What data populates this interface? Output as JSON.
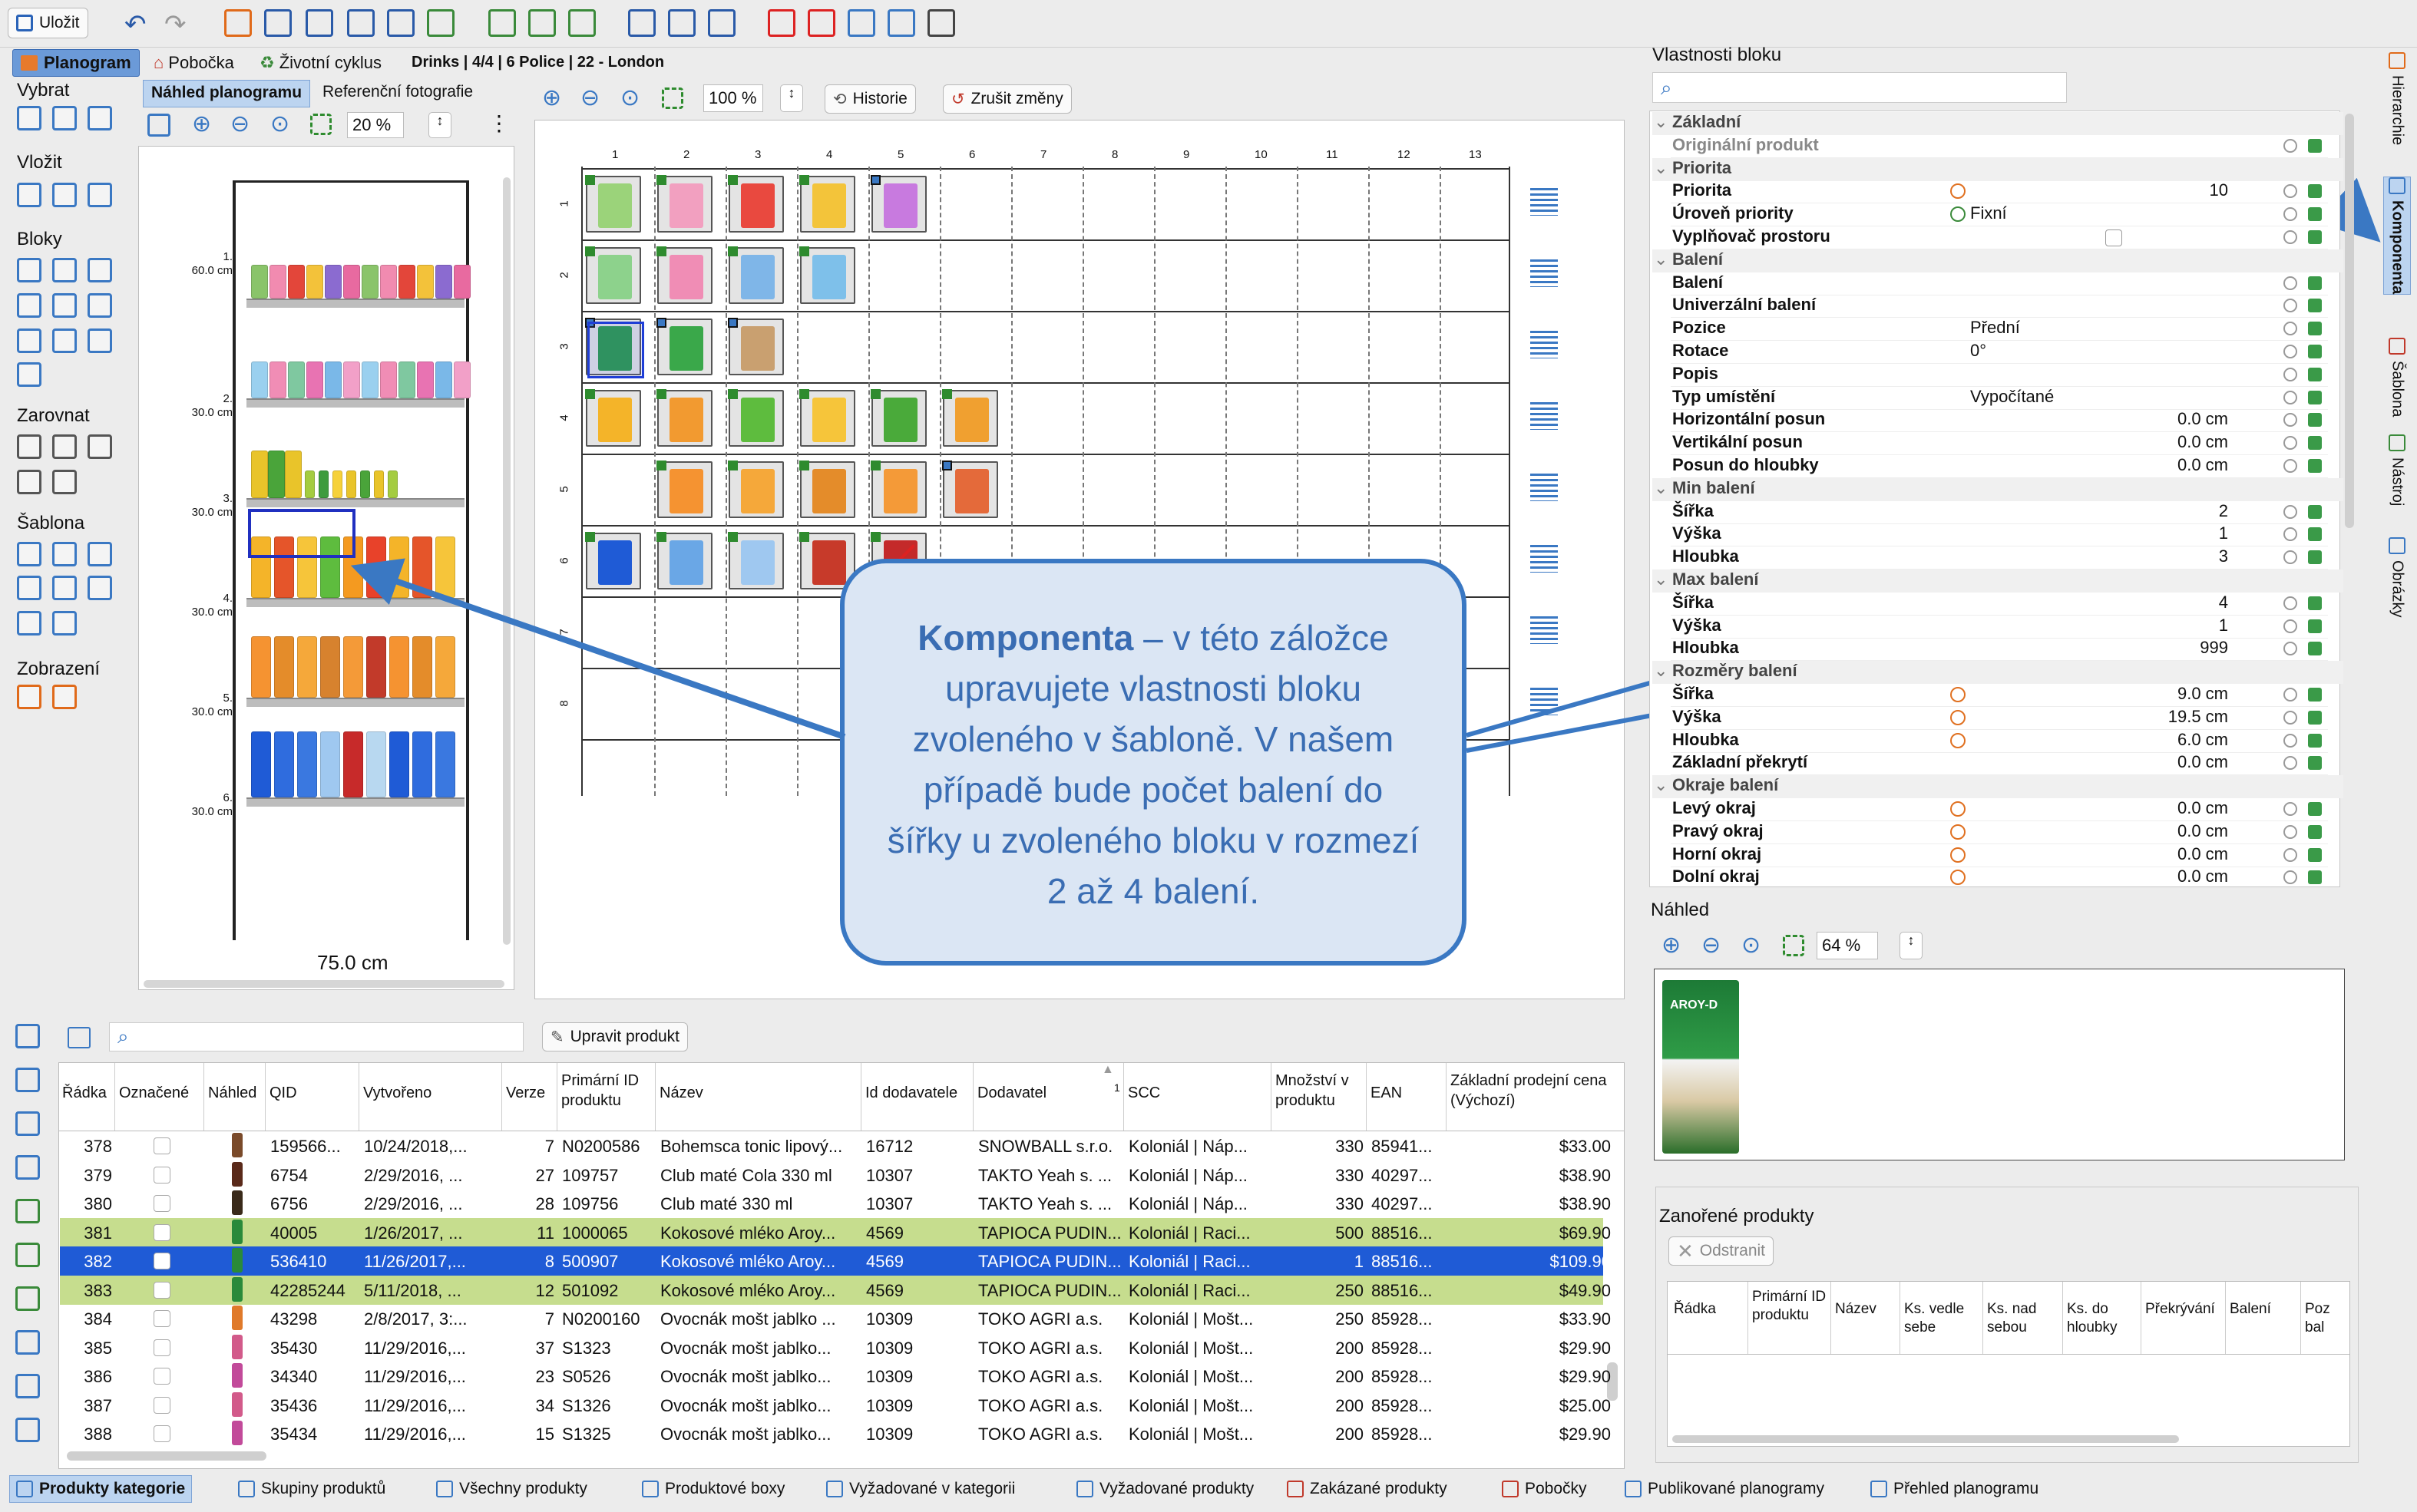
{
  "toolbar": {
    "save_label": "Uložit"
  },
  "breadcrumb": {
    "tab_active": "Planogram",
    "branch": "Pobočka",
    "lifecycle": "Životní cyklus",
    "path": "Drinks | 4/4 | 6 Police | 22 - London"
  },
  "preview_tabs": [
    "Náhled planogramu",
    "Referenční fotografie"
  ],
  "left_zoom": "20 %",
  "center_zoom": "100 %",
  "center_buttons": {
    "history": "Historie",
    "revert": "Zrušit změny"
  },
  "left_sections": [
    "Vybrat",
    "Vložit",
    "Bloky",
    "Zarovnat",
    "Šablona",
    "Zobrazení"
  ],
  "shelves": [
    {
      "n": "1.",
      "h": "60.0 cm"
    },
    {
      "n": "2.",
      "h": "30.0 cm"
    },
    {
      "n": "3.",
      "h": "30.0 cm"
    },
    {
      "n": "4.",
      "h": "30.0 cm"
    },
    {
      "n": "5.",
      "h": "30.0 cm"
    },
    {
      "n": "6.",
      "h": "30.0 cm"
    }
  ],
  "shelf_width": "75.0 cm",
  "grid_cols": [
    "1",
    "2",
    "3",
    "4",
    "5",
    "6",
    "7",
    "8",
    "9",
    "10",
    "11",
    "12",
    "13"
  ],
  "grid_rows": [
    "1",
    "2",
    "3",
    "4",
    "5",
    "6",
    "7",
    "8"
  ],
  "callout": {
    "title": "Komponenta",
    "text": " – v této záložce upravujete vlastnosti bloku zvoleného v šabloně. V našem případě bude počet balení do šířky u zvoleného bloku v rozmezí 2 až 4 balení."
  },
  "properties": {
    "title": "Vlastnosti bloku",
    "rows": [
      {
        "k": "Základní",
        "sec": true
      },
      {
        "k": "Originální produkt",
        "sub": true
      },
      {
        "k": "Priorita",
        "sec": true
      },
      {
        "k": "Priorita",
        "vr": "10",
        "orange": true
      },
      {
        "k": "Úroveň priority",
        "v": "Fixní",
        "green": true
      },
      {
        "k": "Vyplňovač prostoru",
        "check": true
      },
      {
        "k": "Balení",
        "sec": true
      },
      {
        "k": "Balení"
      },
      {
        "k": "Univerzální balení"
      },
      {
        "k": "Pozice",
        "v": "Přední"
      },
      {
        "k": "Rotace",
        "v": "0°"
      },
      {
        "k": "Popis"
      },
      {
        "k": "Typ umístění",
        "v": "Vypočítané"
      },
      {
        "k": "Horizontální posun",
        "vr": "0.0 cm"
      },
      {
        "k": "Vertikální posun",
        "vr": "0.0 cm"
      },
      {
        "k": "Posun do hloubky",
        "vr": "0.0 cm"
      },
      {
        "k": "Min balení",
        "sec": true
      },
      {
        "k": "Šířka",
        "vr": "2"
      },
      {
        "k": "Výška",
        "vr": "1"
      },
      {
        "k": "Hloubka",
        "vr": "3"
      },
      {
        "k": "Max balení",
        "sec": true
      },
      {
        "k": "Šířka",
        "vr": "4"
      },
      {
        "k": "Výška",
        "vr": "1"
      },
      {
        "k": "Hloubka",
        "vr": "999"
      },
      {
        "k": "Rozměry balení",
        "sec": true
      },
      {
        "k": "Šířka",
        "vr": "9.0 cm",
        "orange": true
      },
      {
        "k": "Výška",
        "vr": "19.5 cm",
        "orange": true
      },
      {
        "k": "Hloubka",
        "vr": "6.0 cm",
        "orange": true
      },
      {
        "k": "Základní překrytí",
        "vr": "0.0 cm"
      },
      {
        "k": "Okraje balení",
        "sec": true
      },
      {
        "k": "Levý okraj",
        "vr": "0.0 cm",
        "orange": true
      },
      {
        "k": "Pravý okraj",
        "vr": "0.0 cm",
        "orange": true
      },
      {
        "k": "Horní okraj",
        "vr": "0.0 cm",
        "orange": true
      },
      {
        "k": "Dolní okraj",
        "vr": "0.0 cm",
        "orange": true
      }
    ]
  },
  "right_tabs": [
    "Hierarchie",
    "Komponenta",
    "Šablona",
    "Nástroj",
    "Obrázky"
  ],
  "preview": {
    "title": "Náhled",
    "zoom": "64 %",
    "product_brand": "AROY-D"
  },
  "nested": {
    "title": "Zanořené produkty",
    "remove": "Odstranit",
    "headers": [
      "Řádka",
      "Primární ID produktu",
      "Název",
      "Ks. vedle sebe",
      "Ks. nad sebou",
      "Ks. do hloubky",
      "Překrývání",
      "Balení",
      "Poz bal"
    ]
  },
  "table": {
    "edit_button": "Upravit produkt",
    "headers": [
      "Řádka",
      "Označené",
      "Náhled",
      "QID",
      "Vytvořeno",
      "Verze",
      "Primární ID produktu",
      "Název",
      "Id dodavatele",
      "Dodavatel",
      "SCC",
      "Množství v produktu",
      "EAN",
      "Základní prodejní cena (Výchozí)"
    ],
    "sort_index": "1",
    "rows": [
      {
        "r": "378",
        "qid": "159566...",
        "cr": "10/24/2018,...",
        "ver": "7",
        "pid": "N0200586",
        "name": "Bohemsca tonic lipový...",
        "sid": "16712",
        "sup": "SNOWBALL s.r.o.",
        "scc": "Koloniál | Náp...",
        "qty": "330",
        "ean": "85941...",
        "price": "$33.00",
        "state": ""
      },
      {
        "r": "379",
        "qid": "6754",
        "cr": "2/29/2016, ...",
        "ver": "27",
        "pid": "109757",
        "name": "Club maté Cola 330 ml",
        "sid": "10307",
        "sup": "TAKTO Yeah s. ...",
        "scc": "Koloniál | Náp...",
        "qty": "330",
        "ean": "40297...",
        "price": "$38.90",
        "state": ""
      },
      {
        "r": "380",
        "qid": "6756",
        "cr": "2/29/2016, ...",
        "ver": "28",
        "pid": "109756",
        "name": "Club maté 330 ml",
        "sid": "10307",
        "sup": "TAKTO Yeah s. ...",
        "scc": "Koloniál | Náp...",
        "qty": "330",
        "ean": "40297...",
        "price": "$38.90",
        "state": ""
      },
      {
        "r": "381",
        "qid": "40005",
        "cr": "1/26/2017, ...",
        "ver": "11",
        "pid": "1000065",
        "name": "Kokosové mléko Aroy...",
        "sid": "4569",
        "sup": "TAPIOCA PUDIN...",
        "scc": "Koloniál | Raci...",
        "qty": "500",
        "ean": "88516...",
        "price": "$69.90",
        "state": "green"
      },
      {
        "r": "382",
        "qid": "536410",
        "cr": "11/26/2017,...",
        "ver": "8",
        "pid": "500907",
        "name": "Kokosové mléko Aroy...",
        "sid": "4569",
        "sup": "TAPIOCA PUDIN...",
        "scc": "Koloniál | Raci...",
        "qty": "1",
        "ean": "88516...",
        "price": "$109.90",
        "state": "sel"
      },
      {
        "r": "383",
        "qid": "42285244",
        "cr": "5/11/2018, ...",
        "ver": "12",
        "pid": "501092",
        "name": "Kokosové mléko Aroy...",
        "sid": "4569",
        "sup": "TAPIOCA PUDIN...",
        "scc": "Koloniál | Raci...",
        "qty": "250",
        "ean": "88516...",
        "price": "$49.90",
        "state": "green"
      },
      {
        "r": "384",
        "qid": "43298",
        "cr": "2/8/2017, 3:...",
        "ver": "7",
        "pid": "N0200160",
        "name": "Ovocnák mošt jablko ...",
        "sid": "10309",
        "sup": "TOKO AGRI a.s.",
        "scc": "Koloniál | Mošt...",
        "qty": "250",
        "ean": "85928...",
        "price": "$33.90",
        "state": ""
      },
      {
        "r": "385",
        "qid": "35430",
        "cr": "11/29/2016,...",
        "ver": "37",
        "pid": "S1323",
        "name": "Ovocnák mošt jablko...",
        "sid": "10309",
        "sup": "TOKO AGRI a.s.",
        "scc": "Koloniál | Mošt...",
        "qty": "200",
        "ean": "85928...",
        "price": "$29.90",
        "state": ""
      },
      {
        "r": "386",
        "qid": "34340",
        "cr": "11/29/2016,...",
        "ver": "23",
        "pid": "S0526",
        "name": "Ovocnák mošt jablko...",
        "sid": "10309",
        "sup": "TOKO AGRI a.s.",
        "scc": "Koloniál | Mošt...",
        "qty": "200",
        "ean": "85928...",
        "price": "$29.90",
        "state": ""
      },
      {
        "r": "387",
        "qid": "35436",
        "cr": "11/29/2016,...",
        "ver": "34",
        "pid": "S1326",
        "name": "Ovocnák mošt jablko...",
        "sid": "10309",
        "sup": "TOKO AGRI a.s.",
        "scc": "Koloniál | Mošt...",
        "qty": "200",
        "ean": "85928...",
        "price": "$25.00",
        "state": ""
      },
      {
        "r": "388",
        "qid": "35434",
        "cr": "11/29/2016,...",
        "ver": "15",
        "pid": "S1325",
        "name": "Ovocnák mošt jablko...",
        "sid": "10309",
        "sup": "TOKO AGRI a.s.",
        "scc": "Koloniál | Mošt...",
        "qty": "200",
        "ean": "85928...",
        "price": "$29.90",
        "state": ""
      }
    ]
  },
  "bottom_tabs": [
    "Produkty kategorie",
    "Skupiny produktů",
    "Všechny produkty",
    "Produktové boxy",
    "Vyžadované v kategorii",
    "Vyžadované produkty",
    "Zakázané produkty",
    "Pobočky",
    "Publikované planogramy",
    "Přehled planogramu"
  ],
  "colors": {
    "accent": "#3a78c3",
    "selection": "#1f5bd6",
    "highlight": "#c6dd8e",
    "callout_bg": "#dbe6f4",
    "callout_border": "#3a78c3"
  }
}
